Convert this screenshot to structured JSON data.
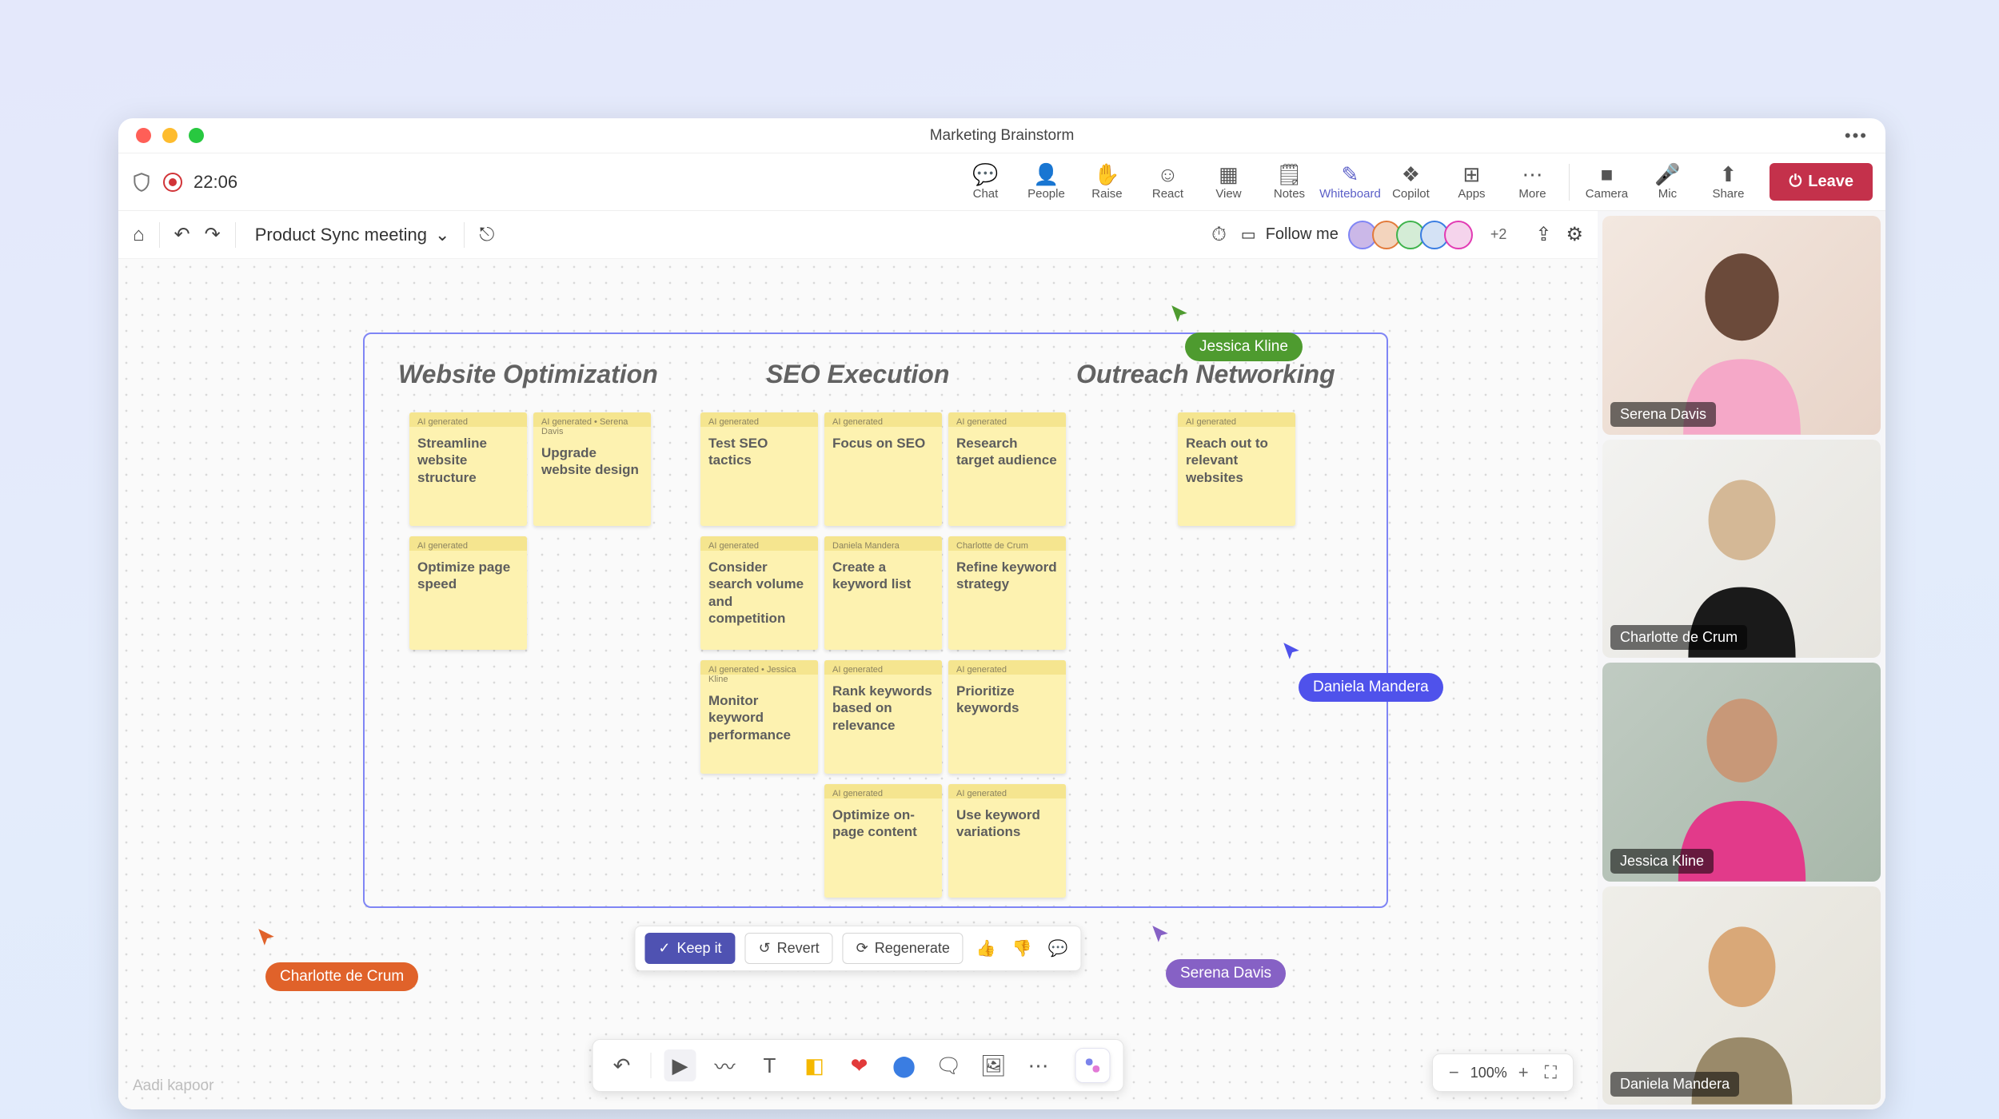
{
  "window_title": "Marketing Brainstorm",
  "recording_time": "22:06",
  "meeting_actions": {
    "chat": "Chat",
    "people": "People",
    "raise": "Raise",
    "react": "React",
    "view": "View",
    "notes": "Notes",
    "whiteboard": "Whiteboard",
    "copilot": "Copilot",
    "apps": "Apps",
    "more": "More",
    "camera": "Camera",
    "mic": "Mic",
    "share": "Share"
  },
  "leave_label": "Leave",
  "whiteboard_name": "Product Sync meeting",
  "follow_label": "Follow me",
  "participant_overflow": "+2",
  "columns": {
    "website": "Website Optimization",
    "seo": "SEO Execution",
    "outreach": "Outreach Networking"
  },
  "tags": {
    "ai": "AI generated",
    "ai_serena": "AI generated • Serena Davis",
    "daniela": "Daniela Mandera",
    "charlotte": "Charlotte de Crum",
    "ai_jessica": "AI generated • Jessica Kline"
  },
  "notes": {
    "w1": "Streamline website structure",
    "w2": "Upgrade website design",
    "w3": "Optimize page speed",
    "s1": "Test SEO tactics",
    "s2": "Focus on SEO",
    "s3": "Research target audience",
    "s4": "Consider search volume and competition",
    "s5": "Create a keyword list",
    "s6": "Refine keyword strategy",
    "s7": "Monitor keyword performance",
    "s8": "Rank keywords based on relevance",
    "s9": "Prioritize keywords",
    "s10": "Optimize on-page content",
    "s11": "Use keyword variations",
    "o1": "Reach out to relevant websites"
  },
  "cursors": {
    "jessica": "Jessica Kline",
    "daniela": "Daniela Mandera",
    "charlotte": "Charlotte de Crum",
    "serena": "Serena Davis"
  },
  "ai_bar": {
    "keep": "Keep it",
    "revert": "Revert",
    "regen": "Regenerate"
  },
  "zoom_level": "100%",
  "watermark": "Aadi kapoor",
  "video": {
    "p1": "Serena Davis",
    "p2": "Charlotte de Crum",
    "p3": "Jessica Kline",
    "p4": "Daniela Mandera"
  }
}
